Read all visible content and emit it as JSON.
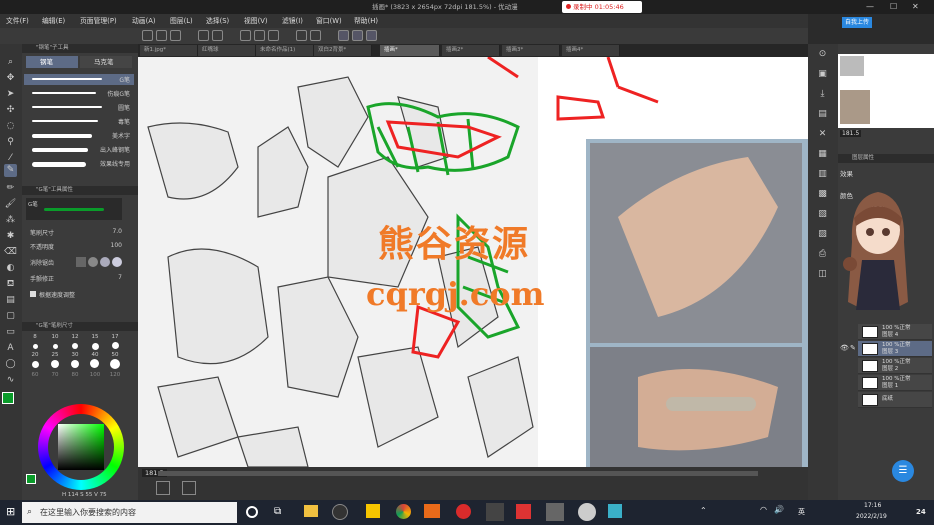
{
  "window": {
    "title": "插画* (3823 x 2654px 72dpi 181.5%) - 优动漫",
    "recording": "录制中 01:05:46"
  },
  "menu": [
    "文件(F)",
    "编辑(E)",
    "页面管理(P)",
    "动画(A)",
    "图层(L)",
    "选择(S)",
    "视图(V)",
    "滤镜(I)",
    "窗口(W)",
    "帮助(H)"
  ],
  "tabs": [
    "新1.jpg*",
    "红嘴球",
    "未命名作品(1)",
    "双白2背景*",
    "插画*",
    "插画2*",
    "插画3*",
    "插画4*"
  ],
  "active_tab": "插画*",
  "left_panel": {
    "pen_header": "\"钢笔\"子工具",
    "sub_tabs": [
      "钢笔",
      "马克笔"
    ],
    "brushes": [
      "G笔",
      "伤痕G笔",
      "圆笔",
      "毒笔",
      "美术字",
      "出入峰钢笔",
      "效果线专用"
    ],
    "prop_header": "\"G笔\"工具属性",
    "prop_brush": "G笔",
    "props": [
      {
        "label": "笔刷尺寸",
        "value": "7.0"
      },
      {
        "label": "不透明度",
        "value": "100"
      },
      {
        "label": "消除锯齿",
        "value": ""
      },
      {
        "label": "手颤修正",
        "value": "7"
      },
      {
        "label": "根据速度调整",
        "value": ""
      }
    ],
    "size_header": "\"G笔\"笔刷尺寸",
    "sizes": [
      "8",
      "10",
      "12",
      "15",
      "17",
      "20",
      "25",
      "30",
      "40",
      "50",
      "60",
      "70",
      "80",
      "100",
      "120"
    ],
    "color_values": [
      "114",
      "55",
      "75"
    ]
  },
  "canvas": {
    "zoom": "181.5",
    "watermark_cn": "熊谷资源",
    "watermark_url": "cqrgj.com"
  },
  "right_panel": {
    "upload_button": "自我上传",
    "zoom_field": "181.5",
    "layer_header": "图层属性",
    "effect_label": "效果",
    "color_label": "颜色",
    "layers": [
      {
        "opacity": "100 %正常",
        "name": "图层 4"
      },
      {
        "opacity": "100 %正常",
        "name": "图层 3"
      },
      {
        "opacity": "100 %正常",
        "name": "图层 2"
      },
      {
        "opacity": "100 %正常",
        "name": "图层 1"
      },
      {
        "opacity": "",
        "name": "底纸"
      }
    ]
  },
  "taskbar": {
    "search_placeholder": "在这里输入你要搜索的内容",
    "lang": "英",
    "time": "17:16",
    "date": "2022/2/19",
    "badge": "24"
  },
  "colors": {
    "accent": "#5d6b86",
    "main_color": "#0a9b2a",
    "record_red": "#dd2222"
  }
}
